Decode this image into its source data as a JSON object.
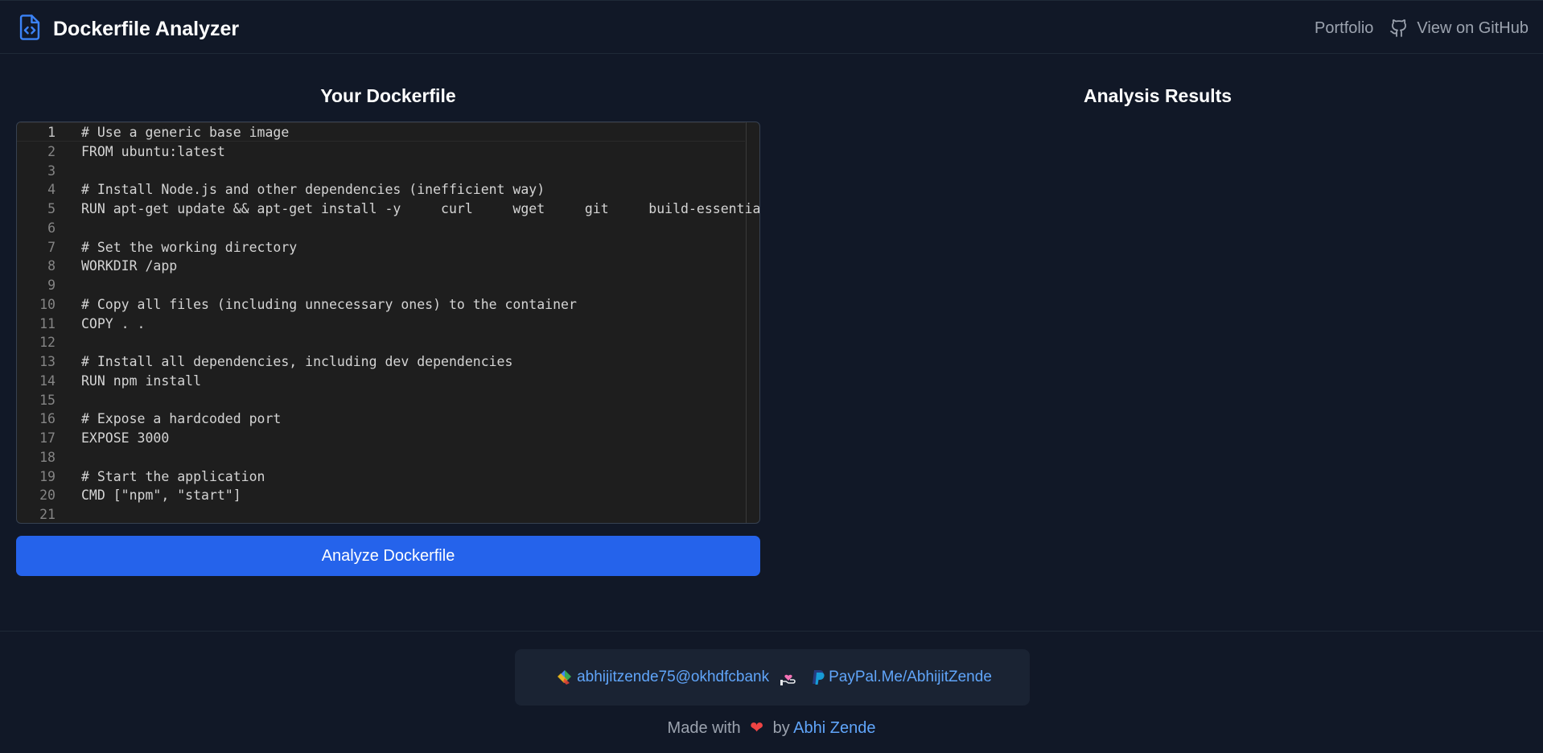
{
  "header": {
    "title": "Dockerfile Analyzer",
    "nav_portfolio": "Portfolio",
    "nav_github": "View on GitHub",
    "logo_icon": "file-code-icon",
    "github_icon": "github-icon"
  },
  "editor": {
    "title": "Your Dockerfile",
    "lines": [
      "# Use a generic base image",
      "FROM ubuntu:latest",
      "",
      "# Install Node.js and other dependencies (inefficient way)",
      "RUN apt-get update && apt-get install -y     curl     wget     git     build-essential",
      "",
      "# Set the working directory",
      "WORKDIR /app",
      "",
      "# Copy all files (including unnecessary ones) to the container",
      "COPY . .",
      "",
      "# Install all dependencies, including dev dependencies",
      "RUN npm install",
      "",
      "# Expose a hardcoded port",
      "EXPOSE 3000",
      "",
      "# Start the application",
      "CMD [\"npm\", \"start\"]",
      ""
    ],
    "line_numbers": [
      "1",
      "2",
      "3",
      "4",
      "5",
      "6",
      "7",
      "8",
      "9",
      "10",
      "11",
      "12",
      "13",
      "14",
      "15",
      "16",
      "17",
      "18",
      "19",
      "20",
      "21"
    ],
    "active_line": 1
  },
  "analyze_button": "Analyze Dockerfile",
  "results": {
    "title": "Analysis Results"
  },
  "footer": {
    "upi": "abhijitzende75@okhdfcbank",
    "paypal": "PayPal.Me/AbhijitZende",
    "made_prefix": "Made with",
    "made_by": "by",
    "author": "Abhi Zende",
    "heart": "❤"
  },
  "colors": {
    "background": "#111827",
    "accent": "#2563eb",
    "link": "#60a5fa"
  }
}
